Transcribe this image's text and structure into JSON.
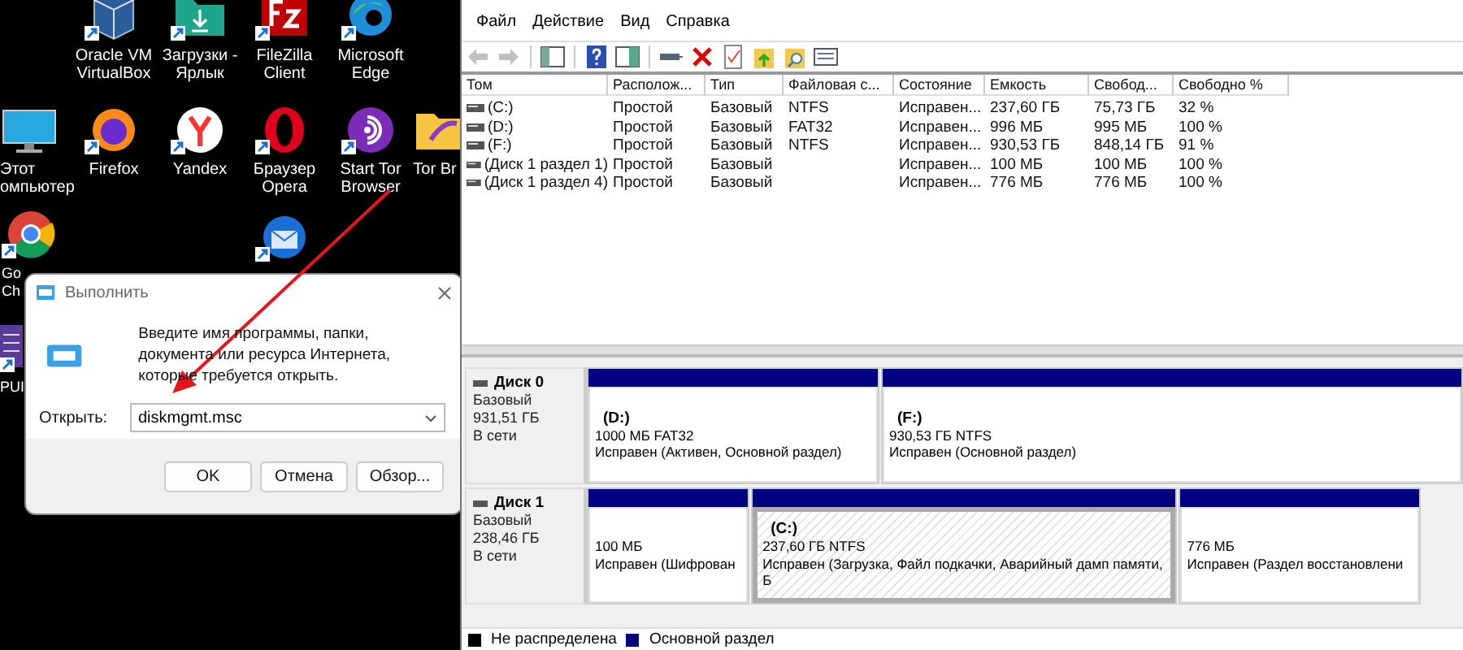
{
  "desktop": {
    "icons": [
      {
        "kind": "virtualbox",
        "label": "Oracle VM VirtualBox",
        "shortcut": true
      },
      {
        "kind": "download-folder",
        "label": "Загрузки - Ярлык",
        "shortcut": true
      },
      {
        "kind": "filezilla",
        "label": "FileZilla Client",
        "shortcut": true
      },
      {
        "kind": "edge",
        "label": "Microsoft Edge",
        "shortcut": true
      },
      {
        "kind": "monitor",
        "label": "Этот омпьютер",
        "shortcut": false
      },
      {
        "kind": "firefox",
        "label": "Firefox",
        "shortcut": true
      },
      {
        "kind": "yandex",
        "label": "Yandex",
        "shortcut": true
      },
      {
        "kind": "opera",
        "label": "Браузер Opera",
        "shortcut": true
      },
      {
        "kind": "tor",
        "label": "Start Tor Browser",
        "shortcut": true
      },
      {
        "kind": "folder",
        "label": "Tor Br",
        "shortcut": false
      },
      {
        "kind": "chrome",
        "label": "Go Ch",
        "shortcut": true
      },
      {
        "kind": "thunderbird",
        "shortcut": true
      },
      {
        "kind": "app",
        "label": "PUI",
        "shortcut": true
      }
    ]
  },
  "run_dialog": {
    "title": "Выполнить",
    "description": "Введите имя программы, папки, документа или ресурса Интернета, которые требуется открыть.",
    "open_label": "Открыть:",
    "value": "diskmgmt.msc",
    "buttons": [
      "OK",
      "Отмена",
      "Обзор..."
    ]
  },
  "disk_management": {
    "menu": [
      "Файл",
      "Действие",
      "Вид",
      "Справка"
    ],
    "toolbar": [
      {
        "kind": "back",
        "disabled": true
      },
      {
        "kind": "forward",
        "disabled": true
      },
      {
        "kind": "sep"
      },
      {
        "kind": "tree",
        "disabled": false
      },
      {
        "kind": "sep"
      },
      {
        "kind": "help",
        "disabled": false
      },
      {
        "kind": "pane",
        "disabled": false
      },
      {
        "kind": "sep"
      },
      {
        "kind": "connect",
        "disabled": false
      },
      {
        "kind": "delete",
        "disabled": false
      },
      {
        "kind": "check",
        "disabled": false
      },
      {
        "kind": "import",
        "disabled": false
      },
      {
        "kind": "find",
        "disabled": false
      },
      {
        "kind": "list",
        "disabled": false
      }
    ],
    "table": {
      "columns": [
        "Том",
        "Располож...",
        "Тип",
        "Файловая с...",
        "Состояние",
        "Емкость",
        "Свобод...",
        "Свободно %"
      ],
      "rows": [
        [
          "(C:)",
          "Простой",
          "Базовый",
          "NTFS",
          "Исправен...",
          "237,60 ГБ",
          "75,73 ГБ",
          "32 %"
        ],
        [
          "(D:)",
          "Простой",
          "Базовый",
          "FAT32",
          "Исправен...",
          "996 МБ",
          "995 МБ",
          "100 %"
        ],
        [
          "(F:)",
          "Простой",
          "Базовый",
          "NTFS",
          "Исправен...",
          "930,53 ГБ",
          "848,14 ГБ",
          "91 %"
        ],
        [
          "(Диск 1 раздел 1)",
          "Простой",
          "Базовый",
          null,
          "Исправен...",
          "100 МБ",
          "100 МБ",
          "100 %"
        ],
        [
          "(Диск 1 раздел 4)",
          "Простой",
          "Базовый",
          null,
          "Исправен...",
          "776 МБ",
          "776 МБ",
          "100 %"
        ]
      ]
    },
    "disks": [
      {
        "name": "Диск 0",
        "type": "Базовый",
        "size": "931,51 ГБ",
        "status": "В сети",
        "partitions": [
          {
            "letter": "(D:)",
            "size": "1000 МБ FAT32",
            "status": "Исправен (Активен, Основной раздел)",
            "selected": false
          },
          {
            "letter": "(F:)",
            "size": "930,53 ГБ NTFS",
            "status": "Исправен (Основной раздел)",
            "selected": false
          }
        ]
      },
      {
        "name": "Диск 1",
        "type": "Базовый",
        "size": "238,46 ГБ",
        "status": "В сети",
        "partitions": [
          {
            "size": "100 МБ",
            "status": "Исправен (Шифрован",
            "selected": false
          },
          {
            "letter": "(C:)",
            "size": "237,60 ГБ NTFS",
            "status": "Исправен (Загрузка, Файл подкачки, Аварийный дамп памяти, Б",
            "selected": true
          },
          {
            "size": "776 МБ",
            "status": "Исправен (Раздел восстановлени",
            "selected": false
          }
        ]
      }
    ],
    "legend": [
      {
        "label": "Не распределена",
        "color": "#000000"
      },
      {
        "label": "Основной раздел",
        "color": "#000080"
      }
    ]
  }
}
